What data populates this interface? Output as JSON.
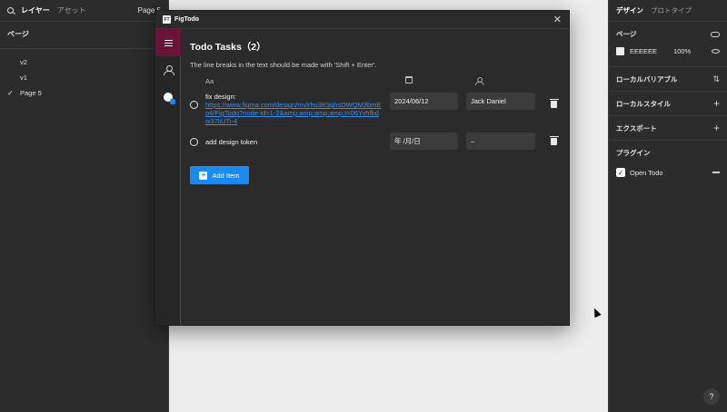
{
  "left_panel": {
    "tabs": [
      "レイヤー",
      "アセット"
    ],
    "current_page": "Page 5",
    "pages_header": "ページ",
    "pages": [
      {
        "name": "v2",
        "current": false
      },
      {
        "name": "v1",
        "current": false
      },
      {
        "name": "Page 5",
        "current": true
      }
    ]
  },
  "right_panel": {
    "tabs": [
      "デザイン",
      "プロトタイプ"
    ],
    "page_label": "ページ",
    "bg_hex": "EEEEEE",
    "bg_opacity": "100%",
    "bg_color": "#EEEEEE",
    "local_variables": "ローカルバリアブル",
    "local_styles": "ローカルスタイル",
    "export": "エクスポート",
    "plugins_label": "プラグイン",
    "plugin_item": "Open Todo",
    "help": "?"
  },
  "plugin": {
    "window_title": "FigTodo",
    "logo_text": "FT",
    "close": "✕",
    "heading": "Todo Tasks（2）",
    "hint": "The line breaks in the text should be made with 'Shift + Enter'.",
    "col_text": "Aa",
    "accent_color": "#6B1336",
    "items": [
      {
        "text": "fix design:",
        "link": "https://www.figma.com/design/mvlrhu3K9ghsDWQM3bmEo4/FigTodo?node-id=1-2&amp;amp;amp;amp;t=06Yvhfbdw37liUTi-4",
        "date": "2024/06/12",
        "assignee": "Jack Daniel"
      },
      {
        "text": "add design token",
        "link": "",
        "date": "年 /月/日",
        "assignee": "–"
      }
    ],
    "add_button": "Add Item",
    "add_color": "#1B8AF0"
  }
}
